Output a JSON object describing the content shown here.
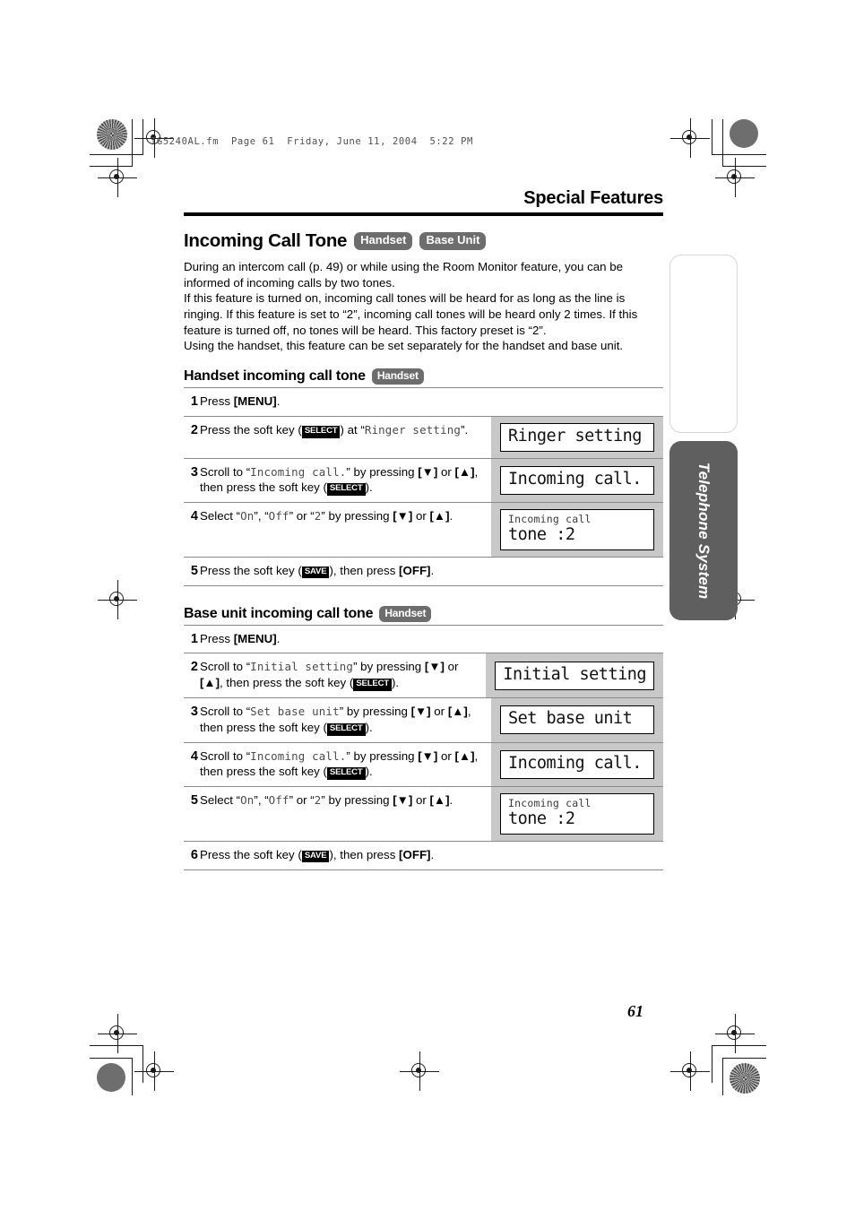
{
  "print_slug": "TG5240AL.fm  Page 61  Friday, June 11, 2004  5:22 PM",
  "running_head": "Special Features",
  "folio": "61",
  "side_tab": {
    "active_label": "Telephone System",
    "blank_label": ""
  },
  "feature": {
    "title": "Incoming Call Tone",
    "badges": [
      "Handset",
      "Base Unit"
    ],
    "intro": [
      "During an intercom call (p. 49) or while using the Room Monitor feature, you can be informed of incoming calls by two tones.",
      "If this feature is turned on, incoming call tones will be heard for as long as the line is ringing. If this feature is set to “2”, incoming call tones will be heard only 2 times. If this feature is turned off, no tones will be heard. This factory preset is “2”.",
      "Using the handset, this feature can be set separately for the handset and base unit."
    ]
  },
  "sections": [
    {
      "heading": "Handset incoming call tone",
      "badge": "Handset",
      "steps": [
        {
          "num": "1",
          "parts": [
            {
              "t": "plain",
              "v": "Press "
            },
            {
              "t": "key",
              "v": "[MENU]"
            },
            {
              "t": "plain",
              "v": "."
            }
          ],
          "lcd": null
        },
        {
          "num": "2",
          "parts": [
            {
              "t": "plain",
              "v": "Press the soft key ("
            },
            {
              "t": "softkey",
              "v": "SELECT"
            },
            {
              "t": "plain",
              "v": ") at “"
            },
            {
              "t": "mono",
              "v": "Ringer setting"
            },
            {
              "t": "plain",
              "v": "”."
            }
          ],
          "lcd": {
            "small": "",
            "big": "Ringer setting"
          }
        },
        {
          "num": "3",
          "parts": [
            {
              "t": "plain",
              "v": "Scroll to “"
            },
            {
              "t": "mono",
              "v": "Incoming call."
            },
            {
              "t": "plain",
              "v": "” by pressing "
            },
            {
              "t": "key",
              "v": "[▼]"
            },
            {
              "t": "plain",
              "v": " or "
            },
            {
              "t": "key",
              "v": "[▲]"
            },
            {
              "t": "plain",
              "v": ", then press the soft key ("
            },
            {
              "t": "softkey",
              "v": "SELECT"
            },
            {
              "t": "plain",
              "v": ")."
            }
          ],
          "lcd": {
            "small": "",
            "big": "Incoming call."
          }
        },
        {
          "num": "4",
          "parts": [
            {
              "t": "plain",
              "v": "Select “"
            },
            {
              "t": "mono",
              "v": "On"
            },
            {
              "t": "plain",
              "v": "”, “"
            },
            {
              "t": "mono",
              "v": "Off"
            },
            {
              "t": "plain",
              "v": "” or “"
            },
            {
              "t": "mono",
              "v": "2"
            },
            {
              "t": "plain",
              "v": "” by pressing "
            },
            {
              "t": "key",
              "v": "[▼]"
            },
            {
              "t": "plain",
              "v": " or "
            },
            {
              "t": "key",
              "v": "[▲]"
            },
            {
              "t": "plain",
              "v": "."
            }
          ],
          "lcd": {
            "small": "Incoming call",
            "big": "tone :2"
          }
        },
        {
          "num": "5",
          "parts": [
            {
              "t": "plain",
              "v": "Press the soft key ("
            },
            {
              "t": "softkey",
              "v": "SAVE"
            },
            {
              "t": "plain",
              "v": "), then press "
            },
            {
              "t": "key",
              "v": "[OFF]"
            },
            {
              "t": "plain",
              "v": "."
            }
          ],
          "lcd": null
        }
      ]
    },
    {
      "heading": "Base unit incoming call tone",
      "badge": "Handset",
      "steps": [
        {
          "num": "1",
          "parts": [
            {
              "t": "plain",
              "v": "Press "
            },
            {
              "t": "key",
              "v": "[MENU]"
            },
            {
              "t": "plain",
              "v": "."
            }
          ],
          "lcd": null
        },
        {
          "num": "2",
          "parts": [
            {
              "t": "plain",
              "v": "Scroll to “"
            },
            {
              "t": "mono",
              "v": "Initial setting"
            },
            {
              "t": "plain",
              "v": "” by pressing "
            },
            {
              "t": "key",
              "v": "[▼]"
            },
            {
              "t": "plain",
              "v": " or "
            },
            {
              "t": "key",
              "v": "[▲]"
            },
            {
              "t": "plain",
              "v": ", then press the soft key ("
            },
            {
              "t": "softkey",
              "v": "SELECT"
            },
            {
              "t": "plain",
              "v": ")."
            }
          ],
          "lcd": {
            "small": "",
            "big": "Initial setting"
          }
        },
        {
          "num": "3",
          "parts": [
            {
              "t": "plain",
              "v": "Scroll to “"
            },
            {
              "t": "mono",
              "v": "Set base unit"
            },
            {
              "t": "plain",
              "v": "” by pressing "
            },
            {
              "t": "key",
              "v": "[▼]"
            },
            {
              "t": "plain",
              "v": " or "
            },
            {
              "t": "key",
              "v": "[▲]"
            },
            {
              "t": "plain",
              "v": ", then press the soft key ("
            },
            {
              "t": "softkey",
              "v": "SELECT"
            },
            {
              "t": "plain",
              "v": ")."
            }
          ],
          "lcd": {
            "small": "",
            "big": "Set base unit"
          }
        },
        {
          "num": "4",
          "parts": [
            {
              "t": "plain",
              "v": "Scroll to “"
            },
            {
              "t": "mono",
              "v": "Incoming call."
            },
            {
              "t": "plain",
              "v": "” by pressing "
            },
            {
              "t": "key",
              "v": "[▼]"
            },
            {
              "t": "plain",
              "v": " or "
            },
            {
              "t": "key",
              "v": "[▲]"
            },
            {
              "t": "plain",
              "v": ", then press the soft key ("
            },
            {
              "t": "softkey",
              "v": "SELECT"
            },
            {
              "t": "plain",
              "v": ")."
            }
          ],
          "lcd": {
            "small": "",
            "big": "Incoming call."
          }
        },
        {
          "num": "5",
          "parts": [
            {
              "t": "plain",
              "v": "Select “"
            },
            {
              "t": "mono",
              "v": "On"
            },
            {
              "t": "plain",
              "v": "”, “"
            },
            {
              "t": "mono",
              "v": "Off"
            },
            {
              "t": "plain",
              "v": "” or “"
            },
            {
              "t": "mono",
              "v": "2"
            },
            {
              "t": "plain",
              "v": "” by pressing "
            },
            {
              "t": "key",
              "v": "[▼]"
            },
            {
              "t": "plain",
              "v": " or "
            },
            {
              "t": "key",
              "v": "[▲]"
            },
            {
              "t": "plain",
              "v": "."
            }
          ],
          "lcd": {
            "small": "Incoming call",
            "big": "tone :2"
          }
        },
        {
          "num": "6",
          "parts": [
            {
              "t": "plain",
              "v": "Press the soft key ("
            },
            {
              "t": "softkey",
              "v": "SAVE"
            },
            {
              "t": "plain",
              "v": "), then press "
            },
            {
              "t": "key",
              "v": "[OFF]"
            },
            {
              "t": "plain",
              "v": "."
            }
          ],
          "lcd": null
        }
      ]
    }
  ]
}
